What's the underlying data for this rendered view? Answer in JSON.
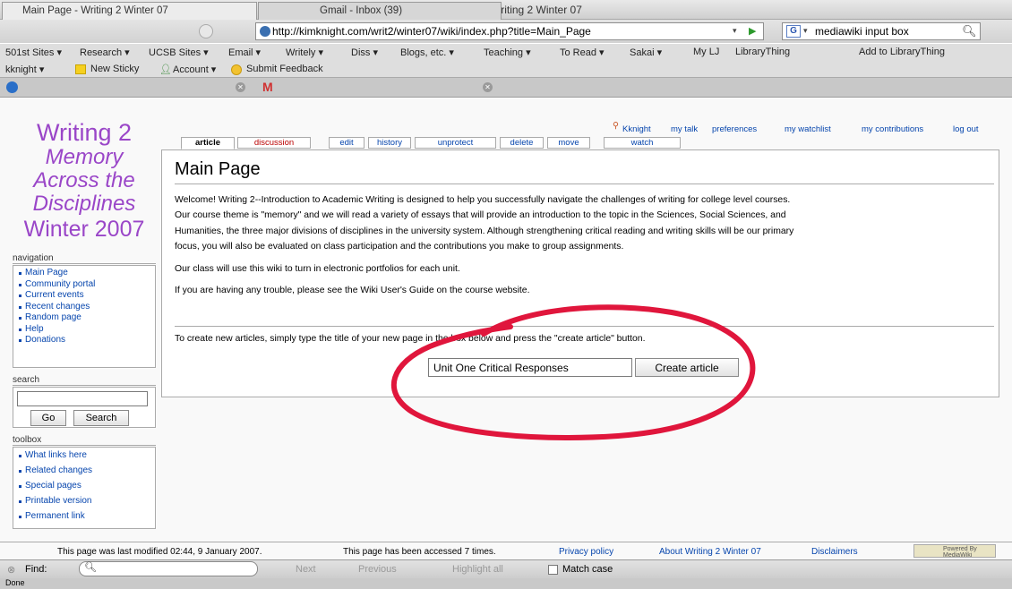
{
  "window": {
    "title": "Main Page - Writing 2 Winter 07"
  },
  "toolbar": {
    "url": "http://kimknight.com/writ2/winter07/wiki/index.php?title=Main_Page",
    "search_value": "mediawiki input box",
    "back_glyph": "⬅",
    "forward_glyph": "➡",
    "reload_glyph": "↻",
    "stop_glyph": "✕",
    "home_glyph": "⌂",
    "print_glyph": "▭"
  },
  "bookmarks": [
    "501st Sites ▾",
    "Research ▾",
    "UCSB Sites ▾",
    "Email ▾",
    "Writely ▾",
    "Diss ▾",
    "Blogs, etc. ▾",
    "Teaching ▾",
    "To Read ▾",
    "Sakai ▾",
    "My LJ",
    "LibraryThing",
    "Add to LibraryThing"
  ],
  "toolbar2": [
    "kknight ▾",
    "New Sticky",
    "Account ▾",
    "Submit Feedback"
  ],
  "tabs": [
    {
      "label": "Main Page - Writing 2 Winter 07"
    },
    {
      "label": "Gmail - Inbox (39)"
    }
  ],
  "logo": {
    "line1": "Writing 2",
    "line2": "Memory",
    "line3": "Across the",
    "line4": "Disciplines",
    "line5": "Winter 2007"
  },
  "personal": [
    "Kknight",
    "my talk",
    "preferences",
    "my watchlist",
    "my contributions",
    "log out"
  ],
  "page_tabs": [
    "article",
    "discussion",
    "edit",
    "history",
    "unprotect",
    "delete",
    "move",
    "watch"
  ],
  "navigation": {
    "heading": "navigation",
    "items": [
      "Main Page",
      "Community portal",
      "Current events",
      "Recent changes",
      "Random page",
      "Help",
      "Donations"
    ]
  },
  "search": {
    "heading": "search",
    "go": "Go",
    "search": "Search"
  },
  "toolbox": {
    "heading": "toolbox",
    "items": [
      "What links here",
      "Related changes",
      "Special pages",
      "Printable version",
      "Permanent link"
    ]
  },
  "content": {
    "title": "Main Page",
    "lines": [
      "Welcome! Writing 2--Introduction to Academic Writing is designed to help you successfully navigate the challenges of writing for college level courses.",
      "Our course theme is \"memory\" and we will read a variety of essays that will provide an introduction to the topic in the Sciences, Social Sciences, and",
      "Humanities, the three major divisions of disciplines in the university system. Although strengthening critical reading and writing skills will be our primary",
      "focus, you will also be evaluated on class participation and the contributions you make to group assignments."
    ],
    "p2": "Our class will use this wiki to turn in electronic portfolios for each unit.",
    "p3": "If you are having any trouble, please see the Wiki User's Guide on the course website.",
    "create_instructions": "To create new articles, simply type the title of your new page in the box below and press the \"create article\" button.",
    "create_value": "Unit One Critical Responses",
    "create_button": "Create article"
  },
  "footer": {
    "modified": "This page was last modified 02:44, 9 January 2007.",
    "accessed": "This page has been accessed 7 times.",
    "privacy": "Privacy policy",
    "about": "About Writing 2 Winter 07",
    "disclaimers": "Disclaimers",
    "badge": "Powered By MediaWiki"
  },
  "findbar": {
    "label": "Find:",
    "next": "Next",
    "previous": "Previous",
    "highlight": "Highlight all",
    "match_case": "Match case"
  },
  "status": "Done",
  "colors": {
    "annotation": "#e0163c",
    "logo": "#9a46c8",
    "link": "#0645ad"
  }
}
